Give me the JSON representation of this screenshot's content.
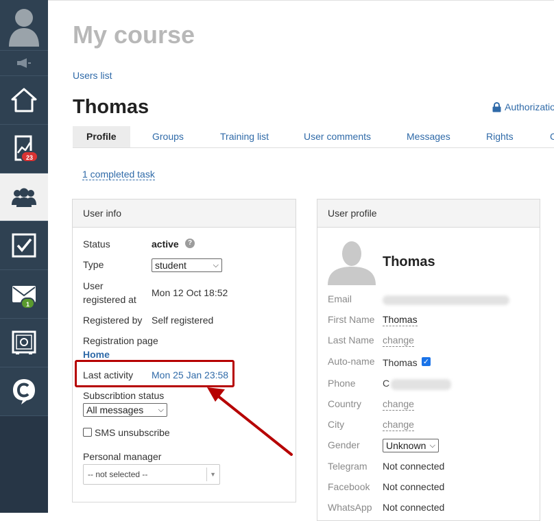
{
  "sidebar": {
    "items": [
      {
        "name": "avatar"
      },
      {
        "name": "announcement-icon"
      },
      {
        "name": "home-icon"
      },
      {
        "name": "stats-icon",
        "badge": "23",
        "badge_color": "#d93333"
      },
      {
        "name": "users-icon",
        "active": true
      },
      {
        "name": "tasks-icon"
      },
      {
        "name": "mail-icon",
        "badge": "1",
        "badge_color": "#5a9a2e"
      },
      {
        "name": "safe-icon"
      },
      {
        "name": "chat-logo-icon"
      }
    ]
  },
  "page": {
    "title": "My course",
    "breadcrumb": "Users list",
    "user_name": "Thomas",
    "auth_link": "Authorizatio"
  },
  "tabs": [
    "Profile",
    "Groups",
    "Training list",
    "User comments",
    "Messages",
    "Rights",
    "C"
  ],
  "completed_task": "1 completed task",
  "user_info": {
    "heading": "User info",
    "status_label": "Status",
    "status_value": "active",
    "type_label": "Type",
    "type_value": "student",
    "registered_at_label": "User registered at",
    "registered_at_value": "Mon 12 Oct 18:52",
    "registered_by_label": "Registered by",
    "registered_by_value": "Self registered",
    "registration_page_label": "Registration page",
    "registration_page_value": "Home",
    "last_activity_label": "Last activity",
    "last_activity_value": "Mon 25 Jan 23:58",
    "subscription_label": "Subscribtion status",
    "subscription_value": "All messages",
    "sms_label": "SMS unsubscribe",
    "manager_label": "Personal manager",
    "manager_value": "-- not selected --"
  },
  "user_profile": {
    "heading": "User profile",
    "name": "Thomas",
    "email_label": "Email",
    "first_name_label": "First Name",
    "first_name_value": "Thomas",
    "last_name_label": "Last Name",
    "last_name_value": "change",
    "autoname_label": "Auto-name",
    "autoname_value": "Thomas",
    "phone_label": "Phone",
    "phone_value": "C",
    "country_label": "Country",
    "country_value": "change",
    "city_label": "City",
    "city_value": "change",
    "gender_label": "Gender",
    "gender_value": "Unknown",
    "telegram_label": "Telegram",
    "telegram_value": "Not connected",
    "facebook_label": "Facebook",
    "facebook_value": "Not connected",
    "whatsapp_label": "WhatsApp",
    "whatsapp_value": "Not connected"
  },
  "colors": {
    "sidebar": "#2f4152",
    "link": "#2f6aa8",
    "annotation": "#b60000"
  }
}
